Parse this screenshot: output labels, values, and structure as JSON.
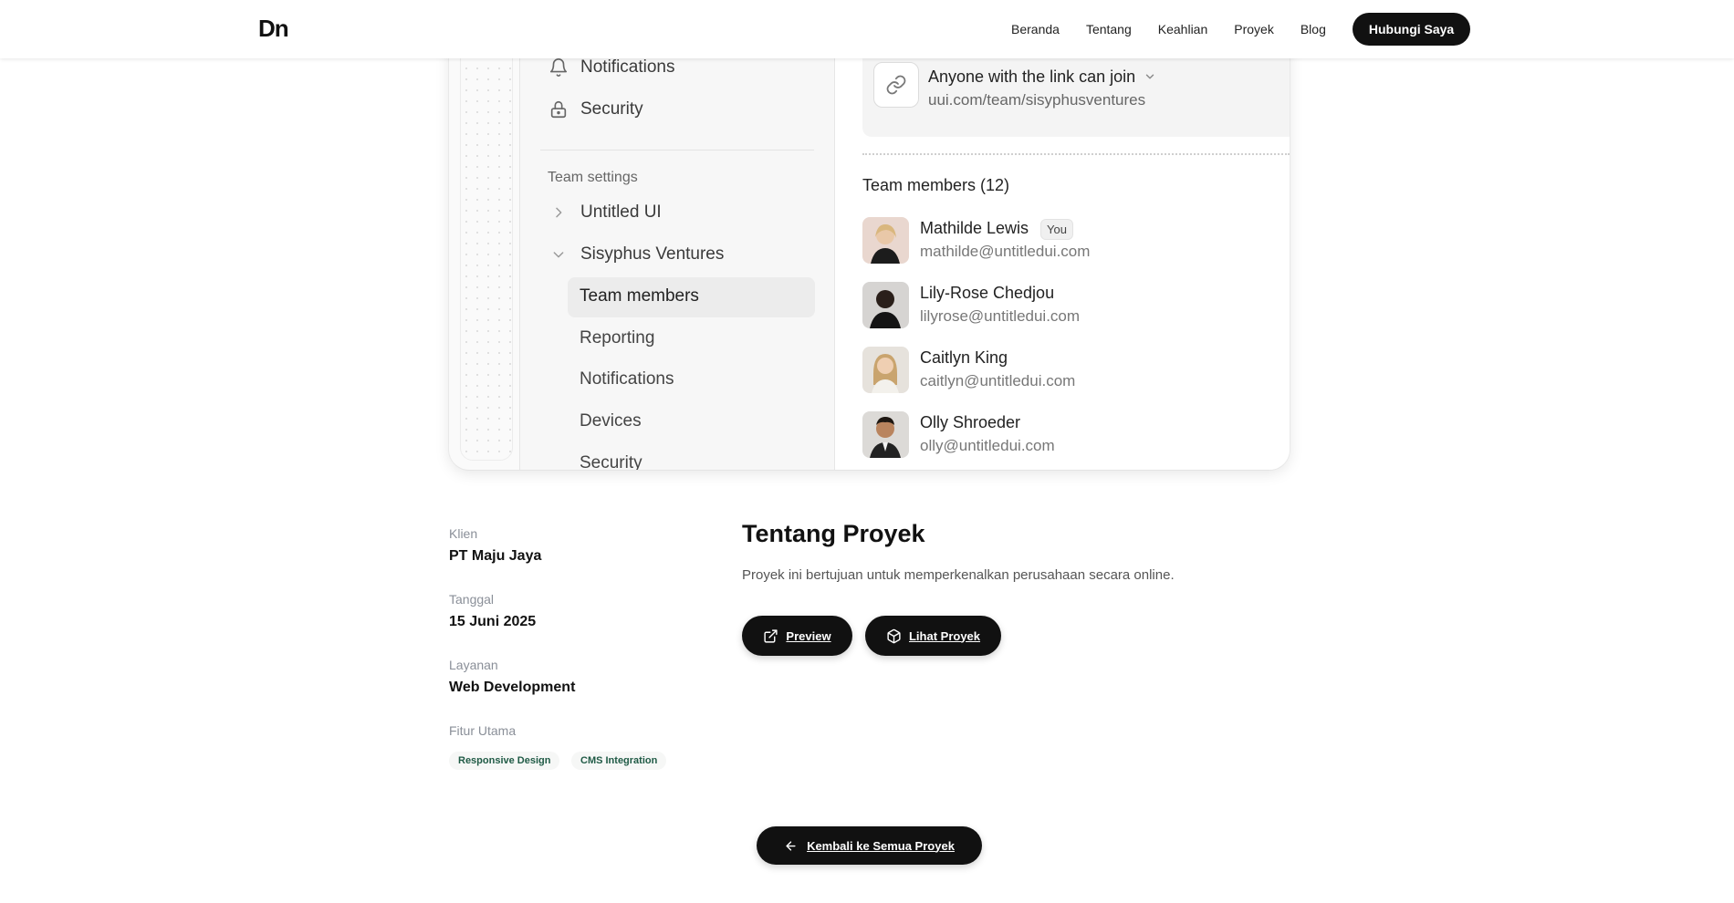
{
  "header": {
    "logo": "Dn",
    "nav": [
      "Beranda",
      "Tentang",
      "Keahlian",
      "Proyek",
      "Blog"
    ],
    "cta": "Hubungi Saya"
  },
  "mockup": {
    "sidebar": {
      "top_items": [
        {
          "label": "Notifications",
          "icon": "bell-icon"
        },
        {
          "label": "Security",
          "icon": "lock-icon"
        }
      ],
      "section_heading": "Team settings",
      "teams": [
        {
          "label": "Untitled UI",
          "icon": "chevron-right-icon"
        },
        {
          "label": "Sisyphus Ventures",
          "icon": "chevron-down-icon"
        }
      ],
      "sub_items": [
        "Team members",
        "Reporting",
        "Notifications",
        "Devices",
        "Security"
      ],
      "active_sub_item": "Team members"
    },
    "link": {
      "title": "Anyone with the link can join",
      "url": "uui.com/team/sisyphusventures"
    },
    "members_title": "Team members (12)",
    "you_badge": "You",
    "members": [
      {
        "name": "Mathilde Lewis",
        "email": "mathilde@untitledui.com"
      },
      {
        "name": "Lily-Rose Chedjou",
        "email": "lilyrose@untitledui.com"
      },
      {
        "name": "Caitlyn King",
        "email": "caitlyn@untitledui.com"
      },
      {
        "name": "Olly Shroeder",
        "email": "olly@untitledui.com"
      }
    ]
  },
  "project": {
    "client_label": "Klien",
    "client": "PT Maju Jaya",
    "date_label": "Tanggal",
    "date": "15 Juni 2025",
    "service_label": "Layanan",
    "service": "Web Development",
    "features_label": "Fitur Utama",
    "features": [
      "Responsive Design",
      "CMS Integration"
    ],
    "about_title": "Tentang Proyek",
    "about_text": "Proyek ini bertujuan untuk memperkenalkan perusahaan secara online.",
    "preview_label": "Preview",
    "view_label": "Lihat Proyek",
    "back_label": "Kembali ke Semua Proyek"
  },
  "colors": {
    "primary": "#111111",
    "muted": "#8a8f98",
    "tag_text": "#1f5a45"
  }
}
